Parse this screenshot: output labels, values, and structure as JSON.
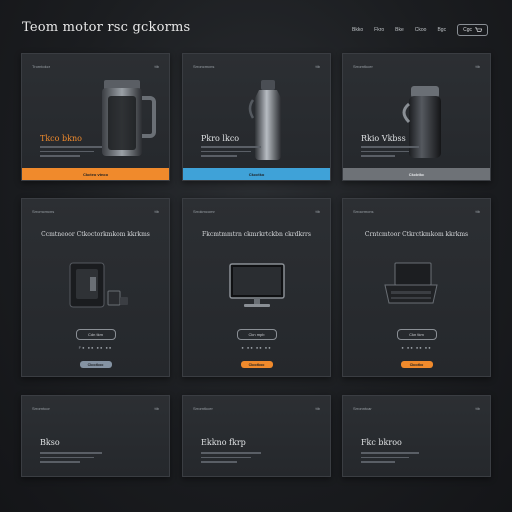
{
  "header": {
    "brand": "Teom motor rsc gckorms",
    "nav": [
      "Bkko",
      "Fkro",
      "Bke",
      "Ckoo",
      "Bgc"
    ],
    "cart_label": "Cgc"
  },
  "colors": {
    "orange": "#f08a2c",
    "blue": "#3fa2d8",
    "gray": "#6e7277",
    "steel": "#8593a3"
  },
  "row1": [
    {
      "tag": "Trorntokcr",
      "num": "ttb",
      "title": "Tkco bkno",
      "cta": "Ckcteo vtnco",
      "cta_color": "orange",
      "icon": "thermos-mug-icon"
    },
    {
      "tag": "Srroncmcns",
      "num": "ttb",
      "title": "Pkro lkco",
      "cta": "Ckcctko",
      "cta_color": "blue",
      "icon": "thermos-bottle-icon"
    },
    {
      "tag": "Srrorntkcer",
      "num": "ttb",
      "title": "Rkio Vkbss",
      "cta": "Ckcbtkc",
      "cta_color": "gray",
      "icon": "vacuum-flask-icon"
    }
  ],
  "row2": [
    {
      "tag": "Srrcmcmcns",
      "num": "ttb",
      "title": "Ccmtneoor Ctkoctorkmkom kkrkms",
      "pill": "Cdn tkm",
      "specs": "F● ●● ●● ●●",
      "btn": "Ckcctkoo",
      "btn_color": "steel",
      "icon": "coffee-machine-icon"
    },
    {
      "tag": "Srrokmcomr",
      "num": "ttb",
      "title": "Fkcmtmmtrn ckmrkrtckbn ckrdkrrs",
      "pill": "Ckn mpb",
      "specs": "● ●● ●● ●●",
      "btn": "Ckcctkoo",
      "btn_color": "orange",
      "icon": "monitor-icon"
    },
    {
      "tag": "Srrocrmcns",
      "num": "ttb",
      "title": "Crntcmtoor Ctkrctkmkom kkrkms",
      "pill": "Ckn tkm",
      "specs": "● ●● ●● ●●",
      "btn": "Ckcctko",
      "btn_color": "orange",
      "icon": "console-icon"
    }
  ],
  "row3": [
    {
      "tag": "Srrorntcor",
      "num": "ttb",
      "title": "Bkso"
    },
    {
      "tag": "Srrorntkcer",
      "num": "ttb",
      "title": "Ekkno fkrp"
    },
    {
      "tag": "Srronntcar",
      "num": "ttb",
      "title": "Fkc bkroo"
    }
  ]
}
